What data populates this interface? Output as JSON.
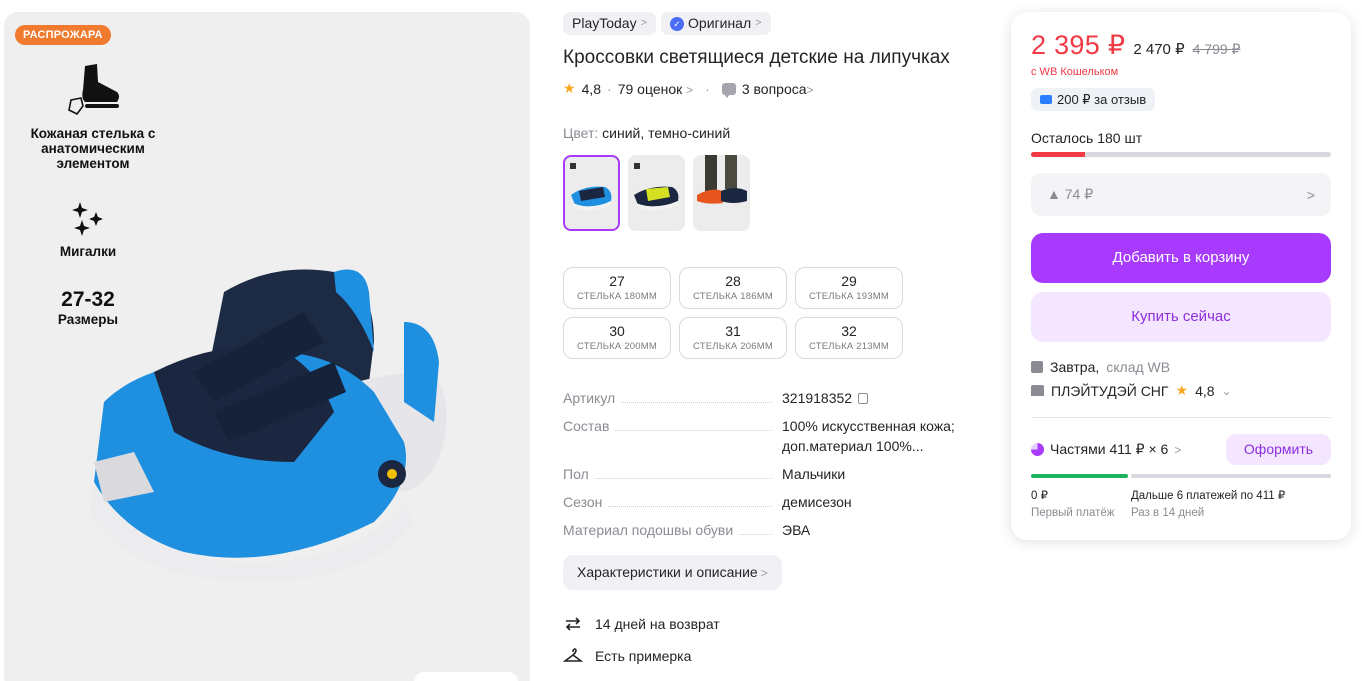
{
  "gallery": {
    "sale_badge": "РАСПРОЖАРА",
    "feature_1": "Кожаная стелька с анатомическим элементом",
    "feature_2": "Мигалки",
    "feature_3_big": "27-32",
    "feature_3_small": "Размеры"
  },
  "chips": {
    "brand": "PlayToday",
    "original": "Оригинал"
  },
  "product": {
    "title": "Кроссовки светящиеся детские на липучках",
    "rating": "4,8",
    "reviews": "79 оценок",
    "questions": "3 вопроса"
  },
  "color": {
    "label": "Цвет:",
    "value": "синий, темно-синий"
  },
  "sizes": [
    {
      "size": "27",
      "insole": "СТЕЛЬКА 180ММ"
    },
    {
      "size": "28",
      "insole": "СТЕЛЬКА 186ММ"
    },
    {
      "size": "29",
      "insole": "СТЕЛЬКА 193ММ"
    },
    {
      "size": "30",
      "insole": "СТЕЛЬКА 200ММ"
    },
    {
      "size": "31",
      "insole": "СТЕЛЬКА 206ММ"
    },
    {
      "size": "32",
      "insole": "СТЕЛЬКА 213ММ"
    }
  ],
  "props": [
    {
      "k": "Артикул",
      "v": "321918352"
    },
    {
      "k": "Состав",
      "v": "100% искусственная кожа; доп.материал 100%..."
    },
    {
      "k": "Пол",
      "v": "Мальчики"
    },
    {
      "k": "Сезон",
      "v": "демисезон"
    },
    {
      "k": "Материал подошвы обуви",
      "v": "ЭВА"
    }
  ],
  "chars_button": "Характеристики и описание",
  "perks": {
    "return": "14 дней на возврат",
    "fitting": "Есть примерка"
  },
  "card": {
    "price": "2 395 ₽",
    "price_no_wallet": "2 470 ₽",
    "price_old": "4 799 ₽",
    "wallet_note": "с WB Кошельком",
    "review_bonus": "200 ₽  за отзыв",
    "stock_text": "Осталось 180 шт",
    "stock_level": 0.18,
    "price_drop": "▲ 74 ₽",
    "add_to_cart": "Добавить в корзину",
    "buy_now": "Купить сейчас",
    "delivery_day": "Завтра,",
    "delivery_warehouse": "склад WB",
    "seller": "ПЛЭЙТУДЭЙ СНГ",
    "seller_rating": "4,8",
    "installment": "Частями 411 ₽ × 6",
    "order_button": "Оформить",
    "first_payment": "0 ₽",
    "first_payment_label": "Первый платёж",
    "next_payments": "Дальше 6 платежей по 411 ₽",
    "next_payments_label": "Раз в 14 дней"
  },
  "colors": {
    "accent": "#a73afd",
    "price_red": "#f23a47",
    "sale_orange": "#f07a2d",
    "pay_green": "#1cb35f"
  }
}
